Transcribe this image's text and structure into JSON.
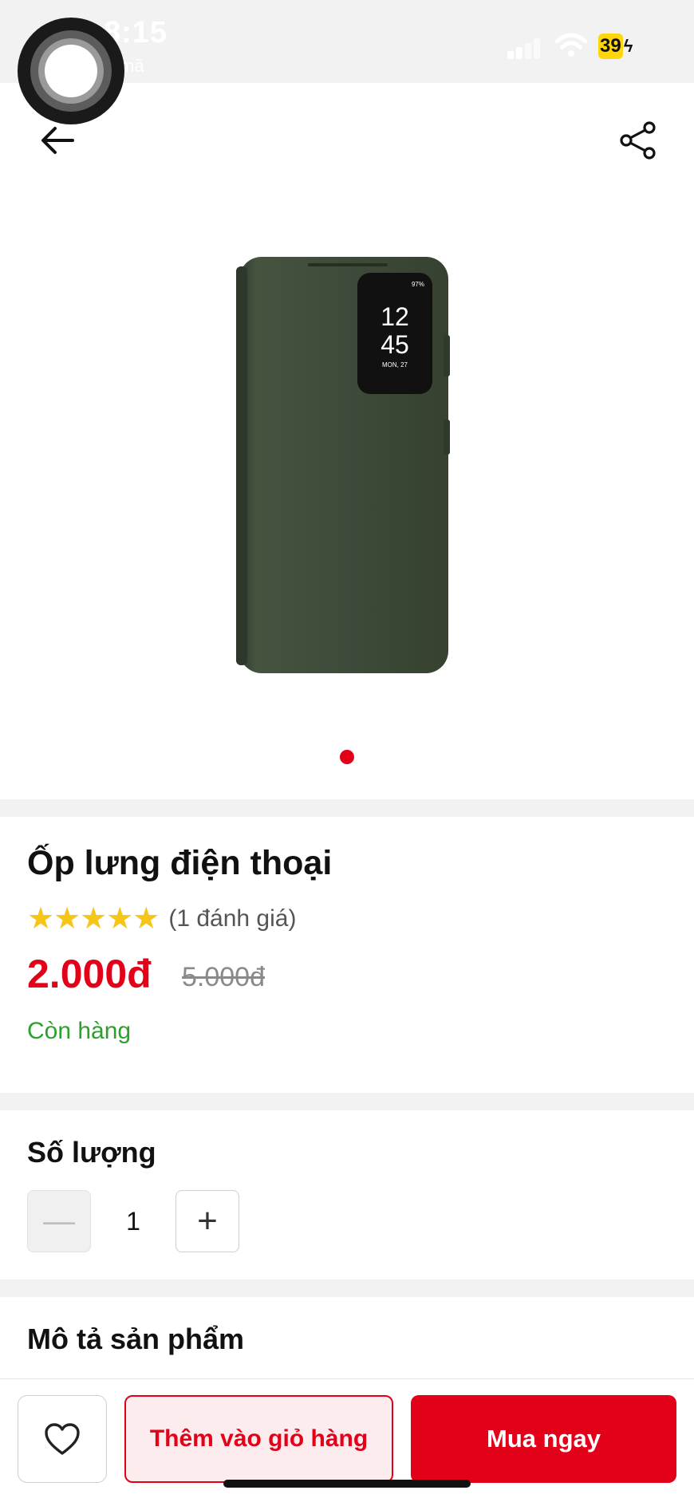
{
  "status_bar": {
    "time": "8:15",
    "sub_text": "mã",
    "battery": "39"
  },
  "nav": {
    "back_icon": "arrow-left-icon",
    "share_icon": "share-icon"
  },
  "gallery": {
    "image_label": "phone-case-image",
    "phone_screen_time_hour": "12",
    "phone_screen_time_min": "45",
    "phone_screen_date": "MON, 27",
    "phone_screen_battery": "97%",
    "slide_count": 1,
    "active_slide": 1
  },
  "product": {
    "title": "Ốp lưng điện thoại",
    "stars": "★★★★★",
    "rating_value": 5,
    "rating_count": "(1 đánh giá)",
    "price": "2.000đ",
    "old_price": "5.000đ",
    "stock_status": "Còn hàng"
  },
  "quantity": {
    "label": "Số lượng",
    "minus": "—",
    "value": "1",
    "plus": "+"
  },
  "description": {
    "title": "Mô tả sản phẩm"
  },
  "actions": {
    "favorite_icon": "heart-icon",
    "add_to_cart": "Thêm vào giỏ hàng",
    "buy_now": "Mua ngay"
  },
  "colors": {
    "accent": "#e30019",
    "stock": "#2ca02c",
    "star": "#f5c518",
    "case": "#3c4a3c"
  }
}
